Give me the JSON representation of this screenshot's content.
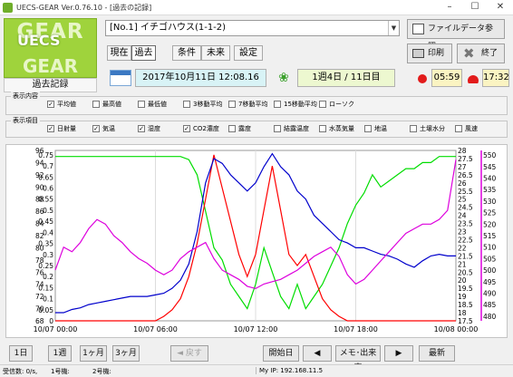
{
  "window": {
    "title": "UECS-GEAR Ver.0.76.10 - [過去の記録]"
  },
  "logo": {
    "top": "GEAR",
    "middle": "UECS",
    "bottom": "GEAR"
  },
  "mode_label": "過去記録",
  "greenhouse_select": {
    "value": "[No.1] イチゴハウス(1-1-2)"
  },
  "tabs": [
    "現在",
    "過去",
    "条件",
    "未来",
    "設定"
  ],
  "actions": {
    "file_data": "ファイルデータ参照...",
    "print": "印刷",
    "exit": "終了"
  },
  "info": {
    "datetime": "2017年10月11日 12:08.16",
    "period": "1週4日 / 11日目",
    "sunrise": "05:59",
    "sunset": "17:32"
  },
  "display_content": {
    "title": "表示内容",
    "options": [
      {
        "label": "平均値",
        "checked": true
      },
      {
        "label": "最高値",
        "checked": false
      },
      {
        "label": "最低値",
        "checked": false
      },
      {
        "label": "3移動平均",
        "checked": false
      },
      {
        "label": "7移動平均",
        "checked": false
      },
      {
        "label": "15移動平均",
        "checked": false
      },
      {
        "label": "ローソク",
        "checked": false
      }
    ]
  },
  "display_items": {
    "title": "表示項目",
    "options": [
      {
        "label": "日射量",
        "checked": true
      },
      {
        "label": "気温",
        "checked": true
      },
      {
        "label": "湿度",
        "checked": true
      },
      {
        "label": "CO2濃度",
        "checked": true
      },
      {
        "label": "露度",
        "checked": false
      },
      {
        "label": "結露温度",
        "checked": false
      },
      {
        "label": "水蒸気量",
        "checked": false
      },
      {
        "label": "地温",
        "checked": false
      },
      {
        "label": "土壌水分",
        "checked": false
      },
      {
        "label": "風速",
        "checked": false
      }
    ]
  },
  "chart_data": {
    "type": "line",
    "x_ticks": [
      "10/07 00:00",
      "10/07 06:00",
      "10/07 12:00",
      "10/07 18:00",
      "10/08 00:00"
    ],
    "y_axes": [
      {
        "side": "left",
        "ticks": [
          "68",
          "70",
          "72",
          "74",
          "76",
          "78",
          "80",
          "82",
          "84",
          "86",
          "88",
          "90",
          "92",
          "94",
          "96"
        ],
        "ylim": [
          68,
          96
        ]
      },
      {
        "side": "left-inner",
        "ticks": [
          "0",
          "0.05",
          "0.1",
          "0.15",
          "0.2",
          "0.25",
          "0.3",
          "0.35",
          "0.4",
          "0.45",
          "0.5",
          "0.55",
          "0.6",
          "0.65",
          "0.7",
          "0.75"
        ],
        "ylim": [
          0,
          0.77
        ]
      },
      {
        "side": "right-inner",
        "ticks": [
          "17.5",
          "18",
          "18.5",
          "19",
          "19.5",
          "20",
          "20.5",
          "21",
          "21.5",
          "22",
          "22.5",
          "23",
          "23.5",
          "24",
          "24.5",
          "25",
          "25.5",
          "26",
          "26.5",
          "27",
          "27.5",
          "28"
        ],
        "ylim": [
          17.5,
          28
        ]
      },
      {
        "side": "right",
        "ticks": [
          "480",
          "485",
          "490",
          "495",
          "500",
          "505",
          "510",
          "515",
          "520",
          "525",
          "530",
          "535",
          "540",
          "545",
          "550"
        ],
        "ylim": [
          478,
          552
        ]
      }
    ],
    "x": [
      0,
      0.5,
      1,
      1.5,
      2,
      2.5,
      3,
      3.5,
      4,
      4.5,
      5,
      5.5,
      6,
      6.5,
      7,
      7.5,
      8,
      8.5,
      9,
      9.5,
      10,
      10.5,
      11,
      11.5,
      12,
      12.5,
      13,
      13.5,
      14,
      14.5,
      15,
      15.5,
      16,
      16.5,
      17,
      17.5,
      18,
      18.5,
      19,
      19.5,
      20,
      20.5,
      21,
      21.5,
      22,
      22.5,
      23,
      23.5,
      24
    ],
    "series": [
      {
        "color": "#00dd00",
        "axis": 0,
        "values": [
          95,
          95,
          95,
          95,
          95,
          95,
          95,
          95,
          95,
          95,
          95,
          95,
          95,
          95,
          95,
          95,
          94.5,
          92,
          86,
          80,
          78,
          74,
          72,
          70,
          74,
          80,
          76,
          72,
          70,
          74,
          70,
          72,
          74,
          77,
          80,
          84,
          87,
          89,
          92,
          90,
          91,
          92,
          93,
          93,
          94,
          94,
          95,
          95,
          95
        ]
      },
      {
        "color": "#ff0000",
        "axis": 1,
        "values": [
          0,
          0,
          0,
          0,
          0,
          0,
          0,
          0,
          0,
          0,
          0,
          0,
          0,
          0.02,
          0.05,
          0.1,
          0.2,
          0.35,
          0.55,
          0.75,
          0.6,
          0.45,
          0.3,
          0.2,
          0.3,
          0.5,
          0.7,
          0.5,
          0.3,
          0.25,
          0.3,
          0.2,
          0.1,
          0.05,
          0.02,
          0,
          0,
          0,
          0,
          0,
          0,
          0,
          0,
          0,
          0,
          0,
          0,
          0,
          0
        ]
      },
      {
        "color": "#0000cc",
        "axis": 2,
        "values": [
          18,
          18,
          18.2,
          18.3,
          18.5,
          18.6,
          18.7,
          18.8,
          18.9,
          19,
          19,
          19,
          19.1,
          19.2,
          19.5,
          20,
          21,
          23,
          26,
          27.5,
          27.2,
          26.5,
          26,
          25.5,
          26,
          27,
          27.8,
          27,
          26.5,
          25.5,
          25,
          24,
          23.5,
          23,
          22.5,
          22.3,
          22,
          22,
          21.8,
          21.6,
          21.5,
          21.3,
          21,
          20.8,
          21.2,
          21.5,
          21.6,
          21.5,
          21.5
        ]
      },
      {
        "color": "#dd00dd",
        "axis": 3,
        "values": [
          500,
          510,
          508,
          512,
          518,
          522,
          520,
          515,
          512,
          508,
          505,
          503,
          500,
          498,
          500,
          505,
          508,
          510,
          512,
          505,
          500,
          498,
          496,
          493,
          492,
          494,
          495,
          496,
          498,
          500,
          503,
          506,
          508,
          510,
          506,
          498,
          494,
          496,
          500,
          504,
          508,
          512,
          516,
          518,
          520,
          520,
          522,
          526,
          548
        ]
      }
    ]
  },
  "nav": {
    "left": [
      "1日",
      "1週",
      "1ヶ月",
      "3ヶ月"
    ],
    "back": "戻す",
    "start_day": "開始日",
    "memo": "メモ･出来事",
    "latest": "最新"
  },
  "status": {
    "received": "受信数: 0/s,",
    "m1": "1号機:",
    "m2": "2号機:",
    "ip": "My IP: 192.168.11.5"
  }
}
